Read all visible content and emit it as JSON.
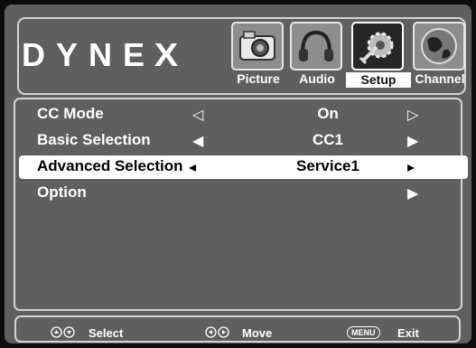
{
  "brand": {
    "text_letters": "DYNE",
    "text_x": "X"
  },
  "tabs": [
    {
      "label": "Picture",
      "icon": "camera-icon",
      "active": false
    },
    {
      "label": "Audio",
      "icon": "headphones-icon",
      "active": false
    },
    {
      "label": "Setup",
      "icon": "gear-tools-icon",
      "active": true
    },
    {
      "label": "Channel",
      "icon": "globe-icon",
      "active": false
    }
  ],
  "menu": {
    "rows": [
      {
        "name": "CC Mode",
        "value": "On",
        "left_arrow": "◁",
        "right_arrow": "▷"
      },
      {
        "name": "Basic Selection",
        "value": "CC1",
        "left_arrow": "◀",
        "right_arrow": "▶"
      },
      {
        "name": "Advanced Selection",
        "value": "Service1",
        "left_arrow": "◂",
        "right_arrow": "▸"
      },
      {
        "name": "Option",
        "value": "",
        "left_arrow": "",
        "right_arrow": "▶"
      }
    ]
  },
  "footer": {
    "select_label": "Select",
    "move_label": "Move",
    "menu_key": "MENU",
    "exit_label": "Exit"
  },
  "colors": {
    "panel": "#5f5f5f",
    "highlight": "#ffffff",
    "text": "#ffffff"
  }
}
